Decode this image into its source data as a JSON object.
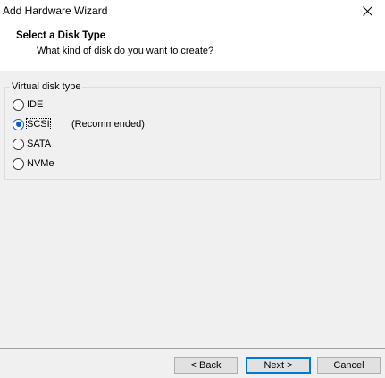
{
  "window": {
    "title": "Add Hardware Wizard",
    "close_icon": "close-icon"
  },
  "header": {
    "title": "Select a Disk Type",
    "subtitle": "What kind of disk do you want to create?"
  },
  "group": {
    "label": "Virtual disk type",
    "options": [
      {
        "label": "IDE",
        "selected": false
      },
      {
        "label": "SCSI",
        "selected": true
      },
      {
        "label": "SATA",
        "selected": false
      },
      {
        "label": "NVMe",
        "selected": false
      }
    ],
    "recommended_note": "(Recommended)"
  },
  "footer": {
    "back_label": "< Back",
    "next_label": "Next >",
    "cancel_label": "Cancel"
  },
  "colors": {
    "accent": "#0078d7",
    "radio_selected": "#0a5ac8"
  }
}
